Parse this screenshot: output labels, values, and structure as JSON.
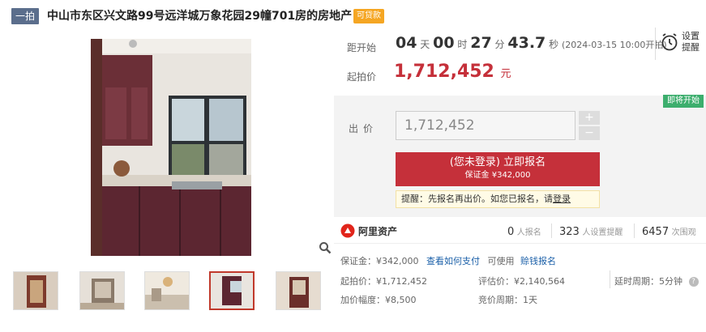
{
  "header": {
    "stage_tag": "一拍",
    "title": "中山市东区兴文路99号远洋城万象花园29幢701房的房地产",
    "loan_badge": "可贷款"
  },
  "countdown": {
    "label": "距开始",
    "days": "04",
    "days_unit": "天",
    "hours": "00",
    "hours_unit": "时",
    "minutes": "27",
    "minutes_unit": "分",
    "seconds": "43.7",
    "seconds_unit": "秒",
    "start_time": "(2024-03-15 10:00开拍)"
  },
  "reminder": {
    "line1": "设置",
    "line2": "提醒"
  },
  "start_price": {
    "label": "起拍价",
    "value": "1,712,452",
    "unit": "元"
  },
  "status_badge": "即将开始",
  "bid": {
    "label": "出价",
    "value": "1,712,452",
    "plus": "+",
    "minus": "−"
  },
  "register_button": {
    "line1": "(您未登录) 立即报名",
    "line2": "保证金 ¥342,000"
  },
  "tip": {
    "text": "提醒：先报名再出价。如您已报名，请",
    "link": "登录"
  },
  "stats": {
    "platform": "阿里资产",
    "signups": "0",
    "signups_label": "人报名",
    "reminders": "323",
    "reminders_label": "人设置提醒",
    "views": "6457",
    "views_label": "次围观"
  },
  "details": {
    "deposit_label": "保证金：¥342,000",
    "deposit_link": "查看如何支付",
    "deposit_use": "可使用",
    "deposit_use_link": "赊钱报名",
    "start_price": "起拍价：¥1,712,452",
    "appraisal": "评估价：¥2,140,564",
    "delay": "延时周期：5分钟",
    "increment": "加价幅度：¥8,500",
    "cycle": "竞价周期：1天"
  },
  "colors": {
    "accent": "#c5303a",
    "badge_green": "#3cae6d",
    "loan": "#f5a623",
    "stage": "#5b6e8c"
  }
}
